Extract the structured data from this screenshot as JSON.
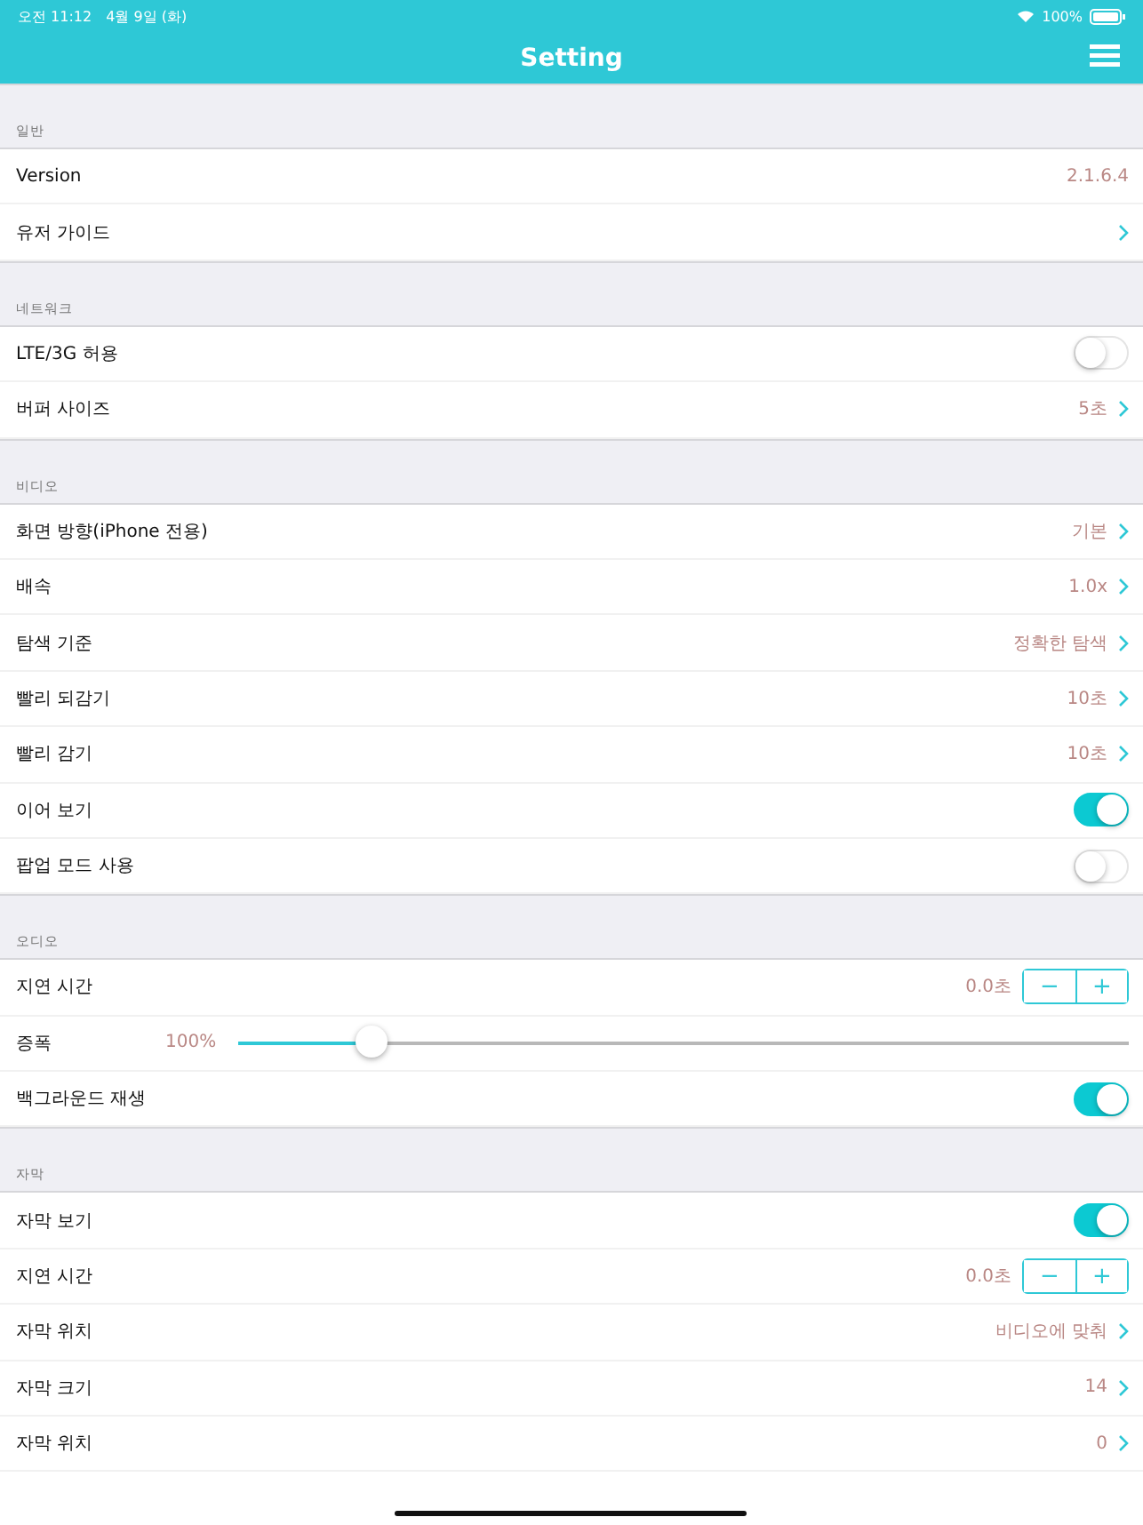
{
  "status_bar": {
    "time": "오전 11:12",
    "date": "4월 9일 (화)",
    "battery": "100%"
  },
  "nav": {
    "title": "Setting"
  },
  "sections": [
    {
      "header": "일반",
      "rows": [
        {
          "kind": "value",
          "label": "Version",
          "value": "2.1.6.4"
        },
        {
          "kind": "link",
          "label": "유저 가이드"
        }
      ]
    },
    {
      "header": "네트워크",
      "rows": [
        {
          "kind": "toggle",
          "label": "LTE/3G 허용",
          "on": false
        },
        {
          "kind": "link",
          "label": "버퍼 사이즈",
          "value": "5초"
        }
      ]
    },
    {
      "header": "비디오",
      "rows": [
        {
          "kind": "link",
          "label": "화면 방향(iPhone 전용)",
          "value": "기본"
        },
        {
          "kind": "link",
          "label": "배속",
          "value": "1.0x"
        },
        {
          "kind": "link",
          "label": "탐색 기준",
          "value": "정확한 탐색"
        },
        {
          "kind": "link",
          "label": "빨리 되감기",
          "value": "10초"
        },
        {
          "kind": "link",
          "label": "빨리 감기",
          "value": "10초"
        },
        {
          "kind": "toggle",
          "label": "이어 보기",
          "on": true
        },
        {
          "kind": "toggle",
          "label": "팝업 모드 사용",
          "on": false
        }
      ]
    },
    {
      "header": "오디오",
      "rows": [
        {
          "kind": "stepper",
          "label": "지연 시간",
          "value": "0.0초",
          "minus": "−",
          "plus": "+"
        },
        {
          "kind": "slider",
          "label": "증폭",
          "value": "100%",
          "level": 0.15
        },
        {
          "kind": "toggle",
          "label": "백그라운드 재생",
          "on": true
        }
      ]
    },
    {
      "header": "자막",
      "rows": [
        {
          "kind": "toggle",
          "label": "자막 보기",
          "on": true
        },
        {
          "kind": "stepper",
          "label": "지연 시간",
          "value": "0.0초",
          "minus": "−",
          "plus": "+"
        },
        {
          "kind": "link",
          "label": "자막 위치",
          "value": "비디오에 맞춰"
        },
        {
          "kind": "link",
          "label": "자막 크기",
          "value": "14"
        },
        {
          "kind": "link",
          "label": "자막 위치",
          "value": "0"
        }
      ]
    }
  ]
}
